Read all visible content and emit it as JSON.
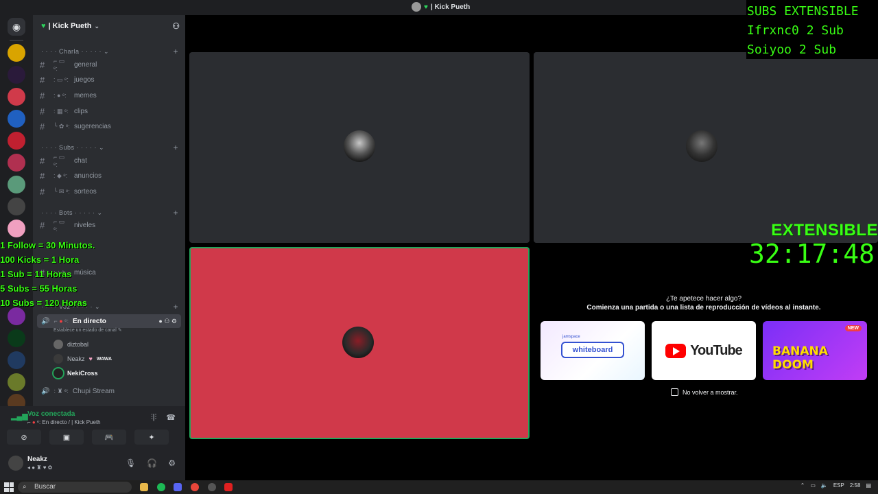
{
  "window": {
    "title": "| Kick Pueth"
  },
  "server": {
    "name": "| Kick Pueth"
  },
  "categories": [
    {
      "label": "Charla",
      "channels": [
        "general",
        "juegos",
        "memes",
        "clips",
        "sugerencias"
      ]
    },
    {
      "label": "Subs",
      "channels": [
        "chat",
        "anuncios",
        "sorteos"
      ]
    },
    {
      "label": "Bots",
      "channels": [
        "niveles"
      ]
    },
    {
      "label": "Voz",
      "channels": []
    }
  ],
  "hidden_channel": "música",
  "voice": {
    "active_channel": "En directo",
    "active_channel_status": "Establece un estado de canal",
    "members": [
      "diztobal",
      "Neakz",
      "NekiCross"
    ],
    "member_tag": "WAWA",
    "other_channel": "Chupi Stream"
  },
  "stream_rules": [
    "1 Follow = 30 Minutos.",
    "100 Kicks = 1 Hora",
    "1 Sub = 11 Horas",
    "5 Subs = 55 Horas",
    "10 Subs = 120 Horas"
  ],
  "voice_panel": {
    "status": "Voz conectada",
    "location": "En directo / | Kick Pueth"
  },
  "user": {
    "name": "Neakz"
  },
  "activity": {
    "question": "¿Te apetece hacer algo?",
    "description": "Comienza una partida o una lista de reproducción de vídeos al instante.",
    "cards": [
      "whiteboard",
      "YouTube",
      "BANANA DOOM"
    ],
    "whiteboard_top": "jamspace",
    "new_badge": "NEW",
    "dont_show": "No volver a mostrar."
  },
  "overlay": {
    "subs_title": "SUBS EXTENSIBLE",
    "subs_lines": [
      "Ifrxnc0 2 Sub",
      "Soiyoo 2 Sub"
    ],
    "timer_label": "EXTENSIBLE",
    "timer_value": "32:17:48"
  },
  "taskbar": {
    "search_placeholder": "Buscar",
    "language": "ESP",
    "clock": "2:58"
  }
}
